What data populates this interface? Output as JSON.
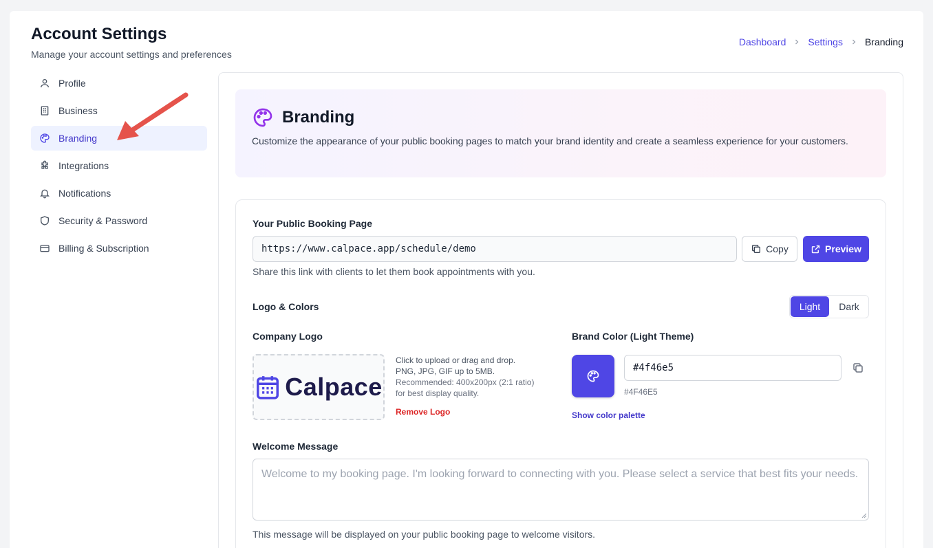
{
  "header": {
    "title": "Account Settings",
    "subtitle": "Manage your account settings and preferences"
  },
  "breadcrumb": {
    "items": [
      "Dashboard",
      "Settings",
      "Branding"
    ]
  },
  "sidebar": {
    "items": [
      {
        "label": "Profile",
        "icon": "user-icon"
      },
      {
        "label": "Business",
        "icon": "building-icon"
      },
      {
        "label": "Branding",
        "icon": "palette-icon",
        "active": true
      },
      {
        "label": "Integrations",
        "icon": "puzzle-icon"
      },
      {
        "label": "Notifications",
        "icon": "bell-icon"
      },
      {
        "label": "Security & Password",
        "icon": "shield-icon"
      },
      {
        "label": "Billing & Subscription",
        "icon": "credit-card-icon"
      }
    ]
  },
  "banner": {
    "title": "Branding",
    "description": "Customize the appearance of your public booking pages to match your brand identity and create a seamless experience for your customers."
  },
  "booking_page": {
    "label": "Your Public Booking Page",
    "url": "https://www.calpace.app/schedule/demo",
    "copy_label": "Copy",
    "preview_label": "Preview",
    "help": "Share this link with clients to let them book appointments with you."
  },
  "logo_colors": {
    "label": "Logo & Colors",
    "theme_options": [
      "Light",
      "Dark"
    ],
    "selected_theme": "Light",
    "company_logo_label": "Company Logo",
    "logo_text": "Calpace",
    "upload_line1": "Click to upload or drag and drop.",
    "upload_line2": "PNG, JPG, GIF up to 5MB.",
    "upload_line3": "Recommended: 400x200px (2:1 ratio)",
    "upload_line4": "for best display quality.",
    "remove_logo": "Remove Logo",
    "brand_color_label": "Brand Color (Light Theme)",
    "brand_color_value": "#4f46e5",
    "brand_color_caption": "#4F46E5",
    "palette_link": "Show color palette"
  },
  "welcome": {
    "label": "Welcome Message",
    "placeholder": "Welcome to my booking page. I'm looking forward to connecting with you. Please select a service that best fits your needs.",
    "help": "This message will be displayed on your public booking page to welcome visitors."
  },
  "colors": {
    "accent": "#4f46e5",
    "annotation_arrow": "#e5534b",
    "danger": "#dc2626"
  }
}
